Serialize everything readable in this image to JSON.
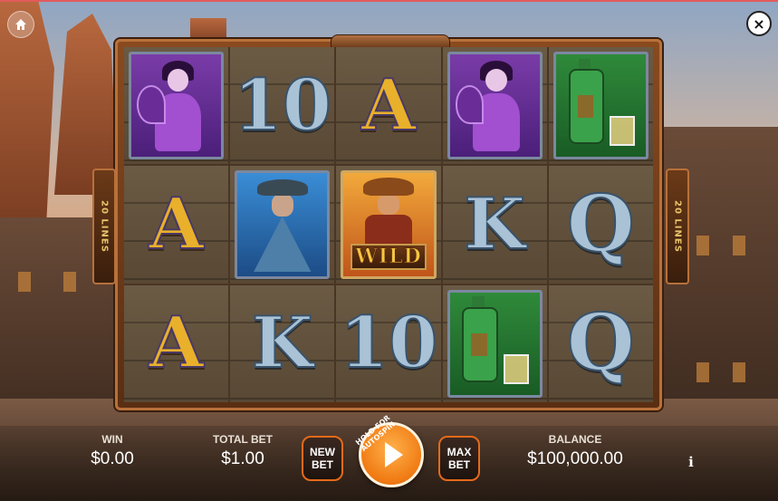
{
  "topbar": {
    "home_icon": "home-icon",
    "close_label": "×"
  },
  "reels": {
    "rows": [
      [
        "lady",
        "10",
        "A",
        "lady",
        "bottle"
      ],
      [
        "A",
        "outlaw",
        "wild",
        "K",
        "Q"
      ],
      [
        "A",
        "K",
        "10",
        "bottle",
        "Q"
      ]
    ],
    "wild_label": "WILD"
  },
  "paylines": {
    "left_label": "20 LINES",
    "right_label": "20 LINES"
  },
  "bottom": {
    "win_label": "WIN",
    "win_value": "$0.00",
    "total_bet_label": "TOTAL BET",
    "total_bet_value": "$1.00",
    "new_bet_label": "NEW\nBET",
    "spin_hint": "HOLD FOR AUTOSPIN",
    "max_bet_label": "MAX\nBET",
    "balance_label": "BALANCE",
    "balance_value": "$100,000.00",
    "info_label": "i"
  },
  "colors": {
    "accent": "#f07a13",
    "gold_symbol": "#e9b02b",
    "silver_symbol": "#a9c2d6"
  }
}
